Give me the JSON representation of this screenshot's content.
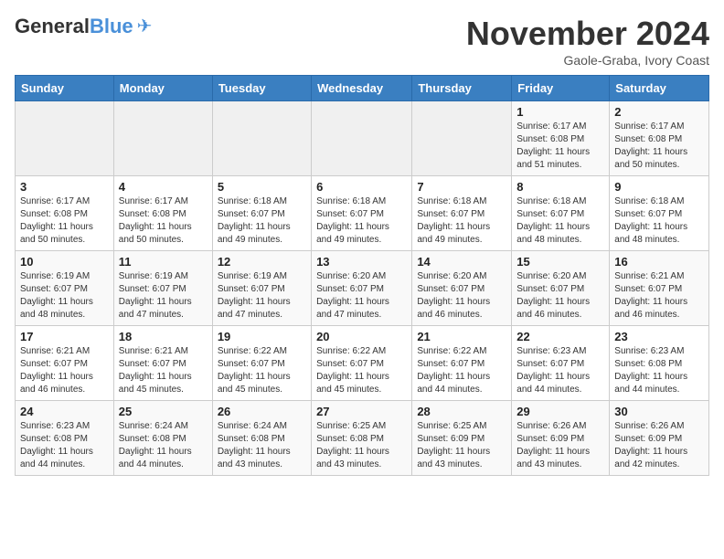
{
  "header": {
    "logo_general": "General",
    "logo_blue": "Blue",
    "month": "November 2024",
    "location": "Gaole-Graba, Ivory Coast"
  },
  "days_of_week": [
    "Sunday",
    "Monday",
    "Tuesday",
    "Wednesday",
    "Thursday",
    "Friday",
    "Saturday"
  ],
  "weeks": [
    [
      {
        "day": "",
        "info": ""
      },
      {
        "day": "",
        "info": ""
      },
      {
        "day": "",
        "info": ""
      },
      {
        "day": "",
        "info": ""
      },
      {
        "day": "",
        "info": ""
      },
      {
        "day": "1",
        "info": "Sunrise: 6:17 AM\nSunset: 6:08 PM\nDaylight: 11 hours and 51 minutes."
      },
      {
        "day": "2",
        "info": "Sunrise: 6:17 AM\nSunset: 6:08 PM\nDaylight: 11 hours and 50 minutes."
      }
    ],
    [
      {
        "day": "3",
        "info": "Sunrise: 6:17 AM\nSunset: 6:08 PM\nDaylight: 11 hours and 50 minutes."
      },
      {
        "day": "4",
        "info": "Sunrise: 6:17 AM\nSunset: 6:08 PM\nDaylight: 11 hours and 50 minutes."
      },
      {
        "day": "5",
        "info": "Sunrise: 6:18 AM\nSunset: 6:07 PM\nDaylight: 11 hours and 49 minutes."
      },
      {
        "day": "6",
        "info": "Sunrise: 6:18 AM\nSunset: 6:07 PM\nDaylight: 11 hours and 49 minutes."
      },
      {
        "day": "7",
        "info": "Sunrise: 6:18 AM\nSunset: 6:07 PM\nDaylight: 11 hours and 49 minutes."
      },
      {
        "day": "8",
        "info": "Sunrise: 6:18 AM\nSunset: 6:07 PM\nDaylight: 11 hours and 48 minutes."
      },
      {
        "day": "9",
        "info": "Sunrise: 6:18 AM\nSunset: 6:07 PM\nDaylight: 11 hours and 48 minutes."
      }
    ],
    [
      {
        "day": "10",
        "info": "Sunrise: 6:19 AM\nSunset: 6:07 PM\nDaylight: 11 hours and 48 minutes."
      },
      {
        "day": "11",
        "info": "Sunrise: 6:19 AM\nSunset: 6:07 PM\nDaylight: 11 hours and 47 minutes."
      },
      {
        "day": "12",
        "info": "Sunrise: 6:19 AM\nSunset: 6:07 PM\nDaylight: 11 hours and 47 minutes."
      },
      {
        "day": "13",
        "info": "Sunrise: 6:20 AM\nSunset: 6:07 PM\nDaylight: 11 hours and 47 minutes."
      },
      {
        "day": "14",
        "info": "Sunrise: 6:20 AM\nSunset: 6:07 PM\nDaylight: 11 hours and 46 minutes."
      },
      {
        "day": "15",
        "info": "Sunrise: 6:20 AM\nSunset: 6:07 PM\nDaylight: 11 hours and 46 minutes."
      },
      {
        "day": "16",
        "info": "Sunrise: 6:21 AM\nSunset: 6:07 PM\nDaylight: 11 hours and 46 minutes."
      }
    ],
    [
      {
        "day": "17",
        "info": "Sunrise: 6:21 AM\nSunset: 6:07 PM\nDaylight: 11 hours and 46 minutes."
      },
      {
        "day": "18",
        "info": "Sunrise: 6:21 AM\nSunset: 6:07 PM\nDaylight: 11 hours and 45 minutes."
      },
      {
        "day": "19",
        "info": "Sunrise: 6:22 AM\nSunset: 6:07 PM\nDaylight: 11 hours and 45 minutes."
      },
      {
        "day": "20",
        "info": "Sunrise: 6:22 AM\nSunset: 6:07 PM\nDaylight: 11 hours and 45 minutes."
      },
      {
        "day": "21",
        "info": "Sunrise: 6:22 AM\nSunset: 6:07 PM\nDaylight: 11 hours and 44 minutes."
      },
      {
        "day": "22",
        "info": "Sunrise: 6:23 AM\nSunset: 6:07 PM\nDaylight: 11 hours and 44 minutes."
      },
      {
        "day": "23",
        "info": "Sunrise: 6:23 AM\nSunset: 6:08 PM\nDaylight: 11 hours and 44 minutes."
      }
    ],
    [
      {
        "day": "24",
        "info": "Sunrise: 6:23 AM\nSunset: 6:08 PM\nDaylight: 11 hours and 44 minutes."
      },
      {
        "day": "25",
        "info": "Sunrise: 6:24 AM\nSunset: 6:08 PM\nDaylight: 11 hours and 44 minutes."
      },
      {
        "day": "26",
        "info": "Sunrise: 6:24 AM\nSunset: 6:08 PM\nDaylight: 11 hours and 43 minutes."
      },
      {
        "day": "27",
        "info": "Sunrise: 6:25 AM\nSunset: 6:08 PM\nDaylight: 11 hours and 43 minutes."
      },
      {
        "day": "28",
        "info": "Sunrise: 6:25 AM\nSunset: 6:09 PM\nDaylight: 11 hours and 43 minutes."
      },
      {
        "day": "29",
        "info": "Sunrise: 6:26 AM\nSunset: 6:09 PM\nDaylight: 11 hours and 43 minutes."
      },
      {
        "day": "30",
        "info": "Sunrise: 6:26 AM\nSunset: 6:09 PM\nDaylight: 11 hours and 42 minutes."
      }
    ]
  ]
}
